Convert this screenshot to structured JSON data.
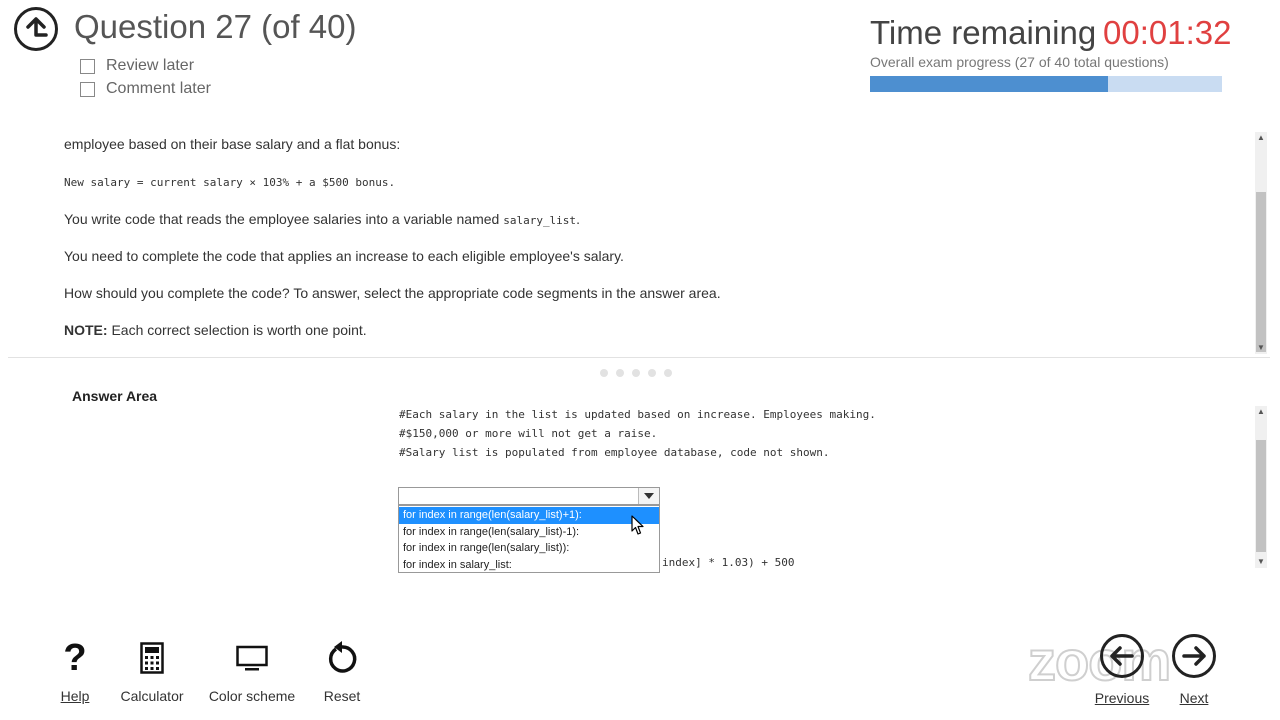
{
  "header": {
    "title": "Question 27 (of 40)",
    "review_later": "Review later",
    "comment_later": "Comment later",
    "time_label": "Time remaining",
    "time_value": "00:01:32",
    "progress_text": "Overall exam progress (27 of 40 total questions)",
    "progress_fraction": 0.675
  },
  "question": {
    "line1": "employee based on their base salary and a flat bonus:",
    "formula": "New salary = current salary × 103% + a $500 bonus.",
    "line3_prefix": "You write code that reads the employee salaries into a variable named ",
    "line3_code": "salary_list",
    "line3_suffix": ".",
    "line4": "You need to complete the code that applies an increase to each eligible employee's salary.",
    "line5": "How should you complete the code? To answer, select the appropriate code segments in the answer area.",
    "note_label": "NOTE:",
    "note_text": " Each correct selection is worth one point."
  },
  "answer": {
    "title": "Answer Area",
    "code1": "#Each salary in the list is updated based on increase. Employees making.",
    "code2": "#$150,000 or more will not get a raise.",
    "code3": "#Salary list is populated from employee database, code not shown.",
    "code_partial": "index] * 1.03) + 500",
    "dropdown_value": "",
    "options": [
      "for index in range(len(salary_list)+1):",
      "for index in range(len(salary_list)-1):",
      "for index in range(len(salary_list)):",
      "for index in salary_list:"
    ]
  },
  "toolbar": {
    "help": "Help",
    "calculator": "Calculator",
    "color_scheme": "Color scheme",
    "reset": "Reset",
    "previous": "Previous",
    "next": "Next"
  },
  "watermark": "zoom",
  "colors": {
    "timer": "#e04040",
    "progress_fill": "#4d8fd0",
    "progress_track": "#c9dcf2",
    "option_highlight": "#1e90ff"
  }
}
